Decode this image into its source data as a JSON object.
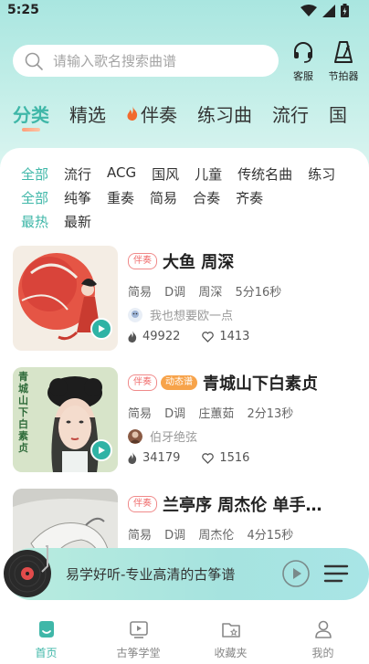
{
  "status_bar": {
    "time": "5:25"
  },
  "search": {
    "placeholder": "请输入歌名搜索曲谱"
  },
  "top_tools": [
    {
      "label": "客服",
      "icon": "headset-icon"
    },
    {
      "label": "节拍器",
      "icon": "metronome-icon"
    }
  ],
  "tabs": [
    {
      "label": "分类",
      "active": true
    },
    {
      "label": "精选"
    },
    {
      "label": "伴奏",
      "icon": "fire-icon"
    },
    {
      "label": "练习曲"
    },
    {
      "label": "流行"
    },
    {
      "label": "国"
    }
  ],
  "filters": {
    "row1": [
      "全部",
      "流行",
      "ACG",
      "国风",
      "儿童",
      "传统名曲",
      "练习"
    ],
    "row2": [
      "全部",
      "纯筝",
      "重奏",
      "简易",
      "合奏",
      "齐奏"
    ],
    "row3": [
      "最热",
      "最新"
    ]
  },
  "songs": [
    {
      "badges": [
        "伴奏"
      ],
      "title": "大鱼 周深",
      "level": "简易",
      "key": "D调",
      "artist": "周深",
      "duration": "5分16秒",
      "uploader": "我也想要欧一点",
      "plays": "49922",
      "likes": "1413"
    },
    {
      "badges": [
        "伴奏",
        "动态谱"
      ],
      "title": "青城山下白素贞",
      "level": "简易",
      "key": "D调",
      "artist": "庄蕙茹",
      "duration": "2分13秒",
      "uploader": "伯牙绝弦",
      "plays": "34179",
      "likes": "1516",
      "cover_text": "青城山下白素贞"
    },
    {
      "badges": [
        "伴奏"
      ],
      "title": "兰亭序 周杰伦 单手…",
      "level": "简易",
      "key": "D调",
      "artist": "周杰伦",
      "duration": "4分15秒"
    }
  ],
  "player": {
    "title": "易学好听-专业高清的古筝谱"
  },
  "bottom_nav": [
    {
      "label": "首页",
      "active": true,
      "icon": "home-icon"
    },
    {
      "label": "古筝学堂",
      "icon": "video-icon"
    },
    {
      "label": "收藏夹",
      "icon": "favorites-folder-icon"
    },
    {
      "label": "我的",
      "icon": "profile-icon"
    }
  ],
  "colors": {
    "accent": "#3fb7a8",
    "header_bg": "#a9e6e0",
    "badge": "#f07070",
    "dynamic_badge": "#f7a34a"
  }
}
